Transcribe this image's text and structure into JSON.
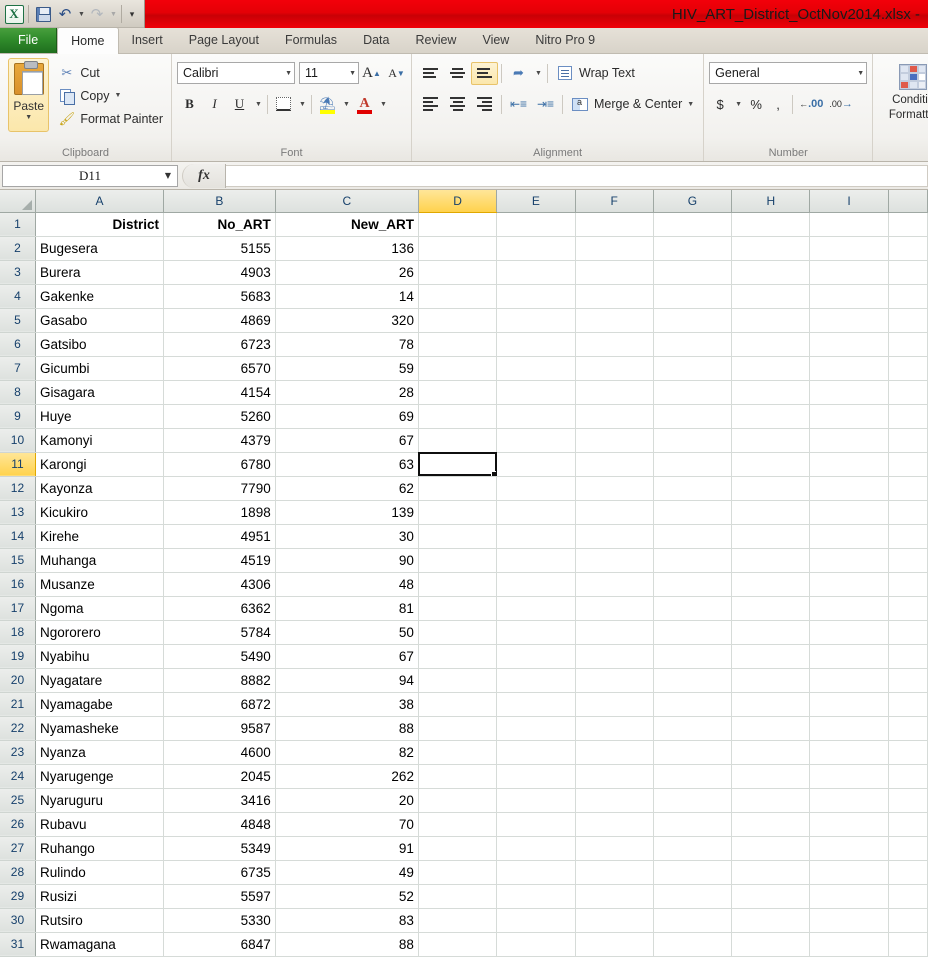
{
  "titlebar": {
    "document_title": "HIV_ART_District_OctNov2014.xlsx -",
    "app_logo": "excel-logo",
    "qat": [
      {
        "name": "save-icon",
        "label": "Save"
      },
      {
        "name": "undo-icon",
        "label": "Undo"
      },
      {
        "name": "redo-icon",
        "label": "Redo"
      },
      {
        "name": "customize-qat-icon",
        "label": "Customize Quick Access Toolbar"
      }
    ],
    "accent_color": "#e40006"
  },
  "ribbon": {
    "tabs": [
      {
        "label": "File",
        "active": false
      },
      {
        "label": "Home",
        "active": true
      },
      {
        "label": "Insert",
        "active": false
      },
      {
        "label": "Page Layout",
        "active": false
      },
      {
        "label": "Formulas",
        "active": false
      },
      {
        "label": "Data",
        "active": false
      },
      {
        "label": "Review",
        "active": false
      },
      {
        "label": "View",
        "active": false
      },
      {
        "label": "Nitro Pro 9",
        "active": false
      }
    ],
    "clipboard": {
      "group_label": "Clipboard",
      "paste_label": "Paste",
      "cut_label": "Cut",
      "copy_label": "Copy",
      "format_painter_label": "Format Painter"
    },
    "font": {
      "group_label": "Font",
      "font_family_value": "Calibri",
      "font_size_value": "11",
      "bold_label": "B",
      "italic_label": "I",
      "underline_label": "U",
      "grow_font_label": "A",
      "shrink_font_label": "A",
      "fill_color": "#ffff00",
      "font_color": "#e00000"
    },
    "alignment": {
      "group_label": "Alignment",
      "wrap_text_label": "Wrap Text",
      "merge_center_label": "Merge & Center",
      "active_vertical_align": "bottom-align"
    },
    "number": {
      "group_label": "Number",
      "format_value": "General",
      "currency_label": "$",
      "percent_label": "%",
      "comma_label": ","
    },
    "styles": {
      "conditional_formatting_line1": "Conditio",
      "conditional_formatting_line2": "Formattin"
    }
  },
  "formula_bar": {
    "name_box_value": "D11",
    "fx_label": "fx",
    "formula_value": ""
  },
  "sheet": {
    "selected_cell": "D11",
    "selected_column": "D",
    "selected_row": 11,
    "column_headers": [
      "A",
      "B",
      "C",
      "D",
      "E",
      "F",
      "G",
      "H",
      "I"
    ],
    "header_row": {
      "row_number": "1",
      "cells": [
        "District",
        "No_ART",
        "New_ART"
      ]
    },
    "rows": [
      {
        "n": "2",
        "district": "Bugesera",
        "no_art": "5155",
        "new_art": "136"
      },
      {
        "n": "3",
        "district": "Burera",
        "no_art": "4903",
        "new_art": "26"
      },
      {
        "n": "4",
        "district": "Gakenke",
        "no_art": "5683",
        "new_art": "14"
      },
      {
        "n": "5",
        "district": "Gasabo",
        "no_art": "4869",
        "new_art": "320"
      },
      {
        "n": "6",
        "district": "Gatsibo",
        "no_art": "6723",
        "new_art": "78"
      },
      {
        "n": "7",
        "district": "Gicumbi",
        "no_art": "6570",
        "new_art": "59"
      },
      {
        "n": "8",
        "district": "Gisagara",
        "no_art": "4154",
        "new_art": "28"
      },
      {
        "n": "9",
        "district": "Huye",
        "no_art": "5260",
        "new_art": "69"
      },
      {
        "n": "10",
        "district": "Kamonyi",
        "no_art": "4379",
        "new_art": "67"
      },
      {
        "n": "11",
        "district": "Karongi",
        "no_art": "6780",
        "new_art": "63"
      },
      {
        "n": "12",
        "district": "Kayonza",
        "no_art": "7790",
        "new_art": "62"
      },
      {
        "n": "13",
        "district": "Kicukiro",
        "no_art": "1898",
        "new_art": "139"
      },
      {
        "n": "14",
        "district": "Kirehe",
        "no_art": "4951",
        "new_art": "30"
      },
      {
        "n": "15",
        "district": "Muhanga",
        "no_art": "4519",
        "new_art": "90"
      },
      {
        "n": "16",
        "district": "Musanze",
        "no_art": "4306",
        "new_art": "48"
      },
      {
        "n": "17",
        "district": "Ngoma",
        "no_art": "6362",
        "new_art": "81"
      },
      {
        "n": "18",
        "district": "Ngororero",
        "no_art": "5784",
        "new_art": "50"
      },
      {
        "n": "19",
        "district": "Nyabihu",
        "no_art": "5490",
        "new_art": "67"
      },
      {
        "n": "20",
        "district": "Nyagatare",
        "no_art": "8882",
        "new_art": "94"
      },
      {
        "n": "21",
        "district": "Nyamagabe",
        "no_art": "6872",
        "new_art": "38"
      },
      {
        "n": "22",
        "district": "Nyamasheke",
        "no_art": "9587",
        "new_art": "88"
      },
      {
        "n": "23",
        "district": "Nyanza",
        "no_art": "4600",
        "new_art": "82"
      },
      {
        "n": "24",
        "district": "Nyarugenge",
        "no_art": "2045",
        "new_art": "262"
      },
      {
        "n": "25",
        "district": "Nyaruguru",
        "no_art": "3416",
        "new_art": "20"
      },
      {
        "n": "26",
        "district": "Rubavu",
        "no_art": "4848",
        "new_art": "70"
      },
      {
        "n": "27",
        "district": "Ruhango",
        "no_art": "5349",
        "new_art": "91"
      },
      {
        "n": "28",
        "district": "Rulindo",
        "no_art": "6735",
        "new_art": "49"
      },
      {
        "n": "29",
        "district": "Rusizi",
        "no_art": "5597",
        "new_art": "52"
      },
      {
        "n": "30",
        "district": "Rutsiro",
        "no_art": "5330",
        "new_art": "83"
      },
      {
        "n": "31",
        "district": "Rwamagana",
        "no_art": "6847",
        "new_art": "88"
      }
    ]
  }
}
